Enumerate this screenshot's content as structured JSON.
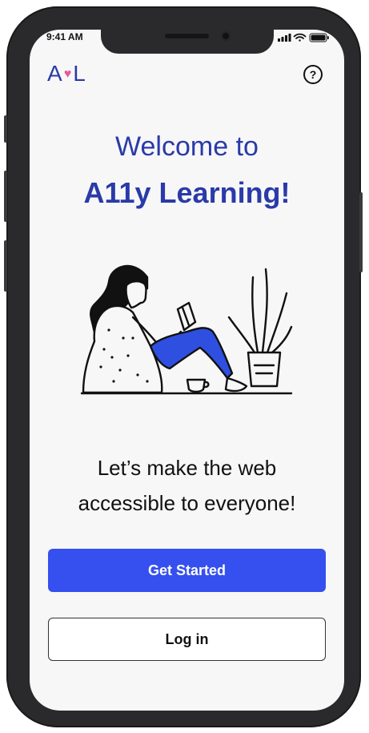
{
  "status_bar": {
    "time": "9:41 AM"
  },
  "header": {
    "logo_left": "A",
    "logo_heart": "♥",
    "logo_right": "L",
    "help_icon_glyph": "?"
  },
  "welcome": {
    "line1": "Welcome to",
    "line2": "A11y Learning!"
  },
  "tagline": {
    "line1": "Let’s make the web",
    "line2": "accessible to everyone!"
  },
  "buttons": {
    "get_started_label": "Get Started",
    "login_label": "Log in"
  },
  "icons": {
    "help": "question-circle-icon",
    "signal": "signal-bars-icon",
    "wifi": "wifi-icon",
    "battery": "battery-icon"
  },
  "colors": {
    "brand_blue": "#2a3aa8",
    "primary_button": "#3550ef",
    "heart_pink": "#e35a9b",
    "device_frame": "#2a2a2c",
    "screen_bg": "#f7f7f8",
    "illustration_blue": "#2f4fe0"
  }
}
